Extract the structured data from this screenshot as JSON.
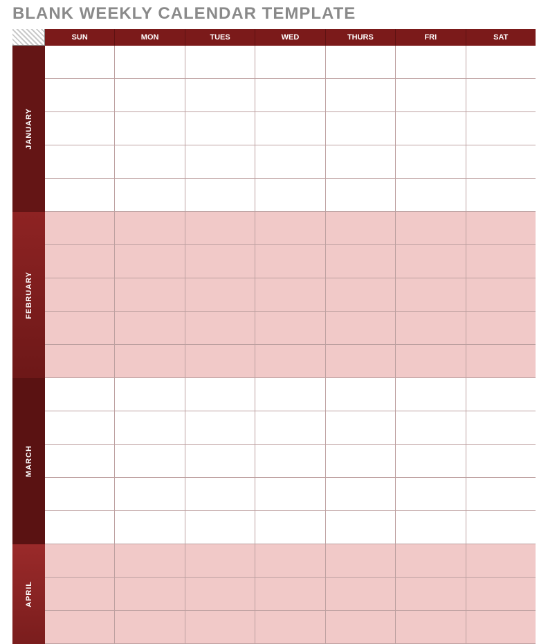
{
  "title": "BLANK WEEKLY CALENDAR TEMPLATE",
  "days": {
    "sun": "SUN",
    "mon": "MON",
    "tues": "TUES",
    "wed": "WED",
    "thurs": "THURS",
    "fri": "FRI",
    "sat": "SAT"
  },
  "months": {
    "jan": "JANUARY",
    "feb": "FEBRUARY",
    "mar": "MARCH",
    "apr": "APRIL"
  },
  "structure": [
    {
      "month_key": "jan",
      "rows": 5,
      "shaded": false
    },
    {
      "month_key": "feb",
      "rows": 5,
      "shaded": true
    },
    {
      "month_key": "mar",
      "rows": 5,
      "shaded": false
    },
    {
      "month_key": "apr",
      "rows": 3,
      "shaded": true
    }
  ],
  "colors": {
    "header_bg": "#7b1a1a",
    "month_tab_dark": "#5a1212",
    "month_tab_mid": "#641515",
    "shaded_cell": "#f1c9c8",
    "grid_line": "#bda0a0",
    "title_gray": "#8a8a8a"
  }
}
